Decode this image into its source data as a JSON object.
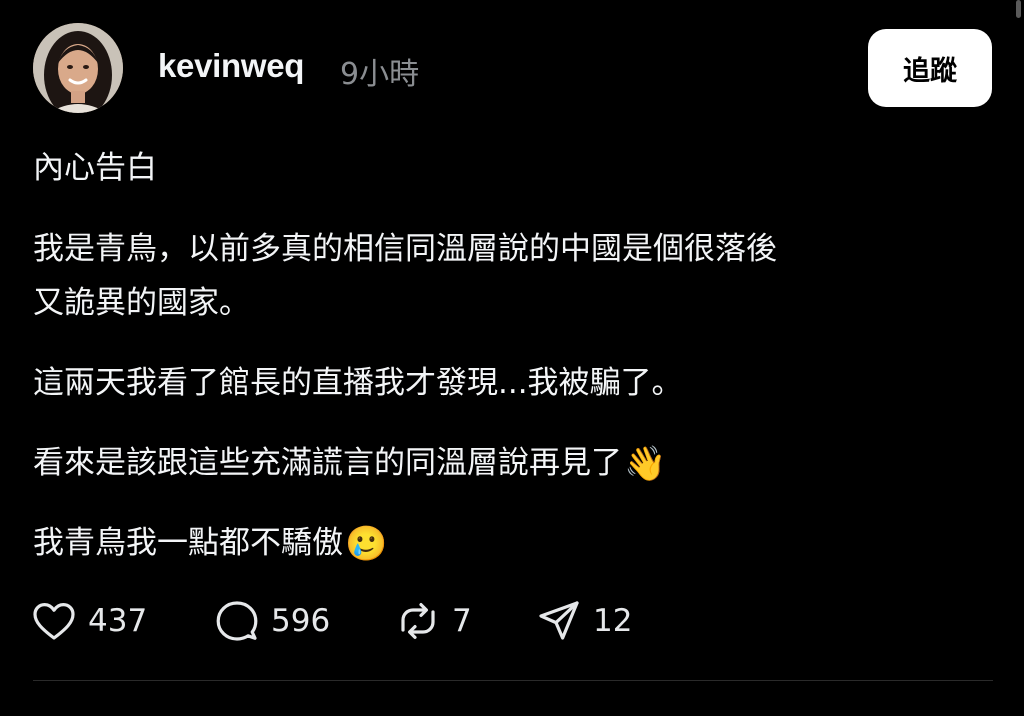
{
  "post": {
    "author": {
      "username": "kevinweq",
      "timestamp": "9小時",
      "avatar": "avatar"
    },
    "follow_label": "追蹤",
    "paragraphs": [
      {
        "text": "內心告白",
        "emoji": ""
      },
      {
        "text": "我是青鳥，以前多真的相信同溫層說的中國是個很落後\n又詭異的國家。",
        "emoji": ""
      },
      {
        "text": "這兩天我看了館長的直播我才發現...我被騙了。",
        "emoji": ""
      },
      {
        "text": "看來是該跟這些充滿謊言的同溫層說再見了",
        "emoji": "👋"
      },
      {
        "text": "我青鳥我一點都不驕傲",
        "emoji": "🥲"
      }
    ],
    "actions": {
      "likes": "437",
      "comments": "596",
      "reposts": "7",
      "shares": "12"
    }
  },
  "colors": {
    "background": "#000000",
    "text": "#f3f5f7",
    "muted": "#8a8d91",
    "button_bg": "#ffffff"
  },
  "icons": {
    "like": "heart-icon",
    "comment": "speech-bubble-icon",
    "repost": "repost-arrows-icon",
    "share": "paper-plane-icon"
  }
}
